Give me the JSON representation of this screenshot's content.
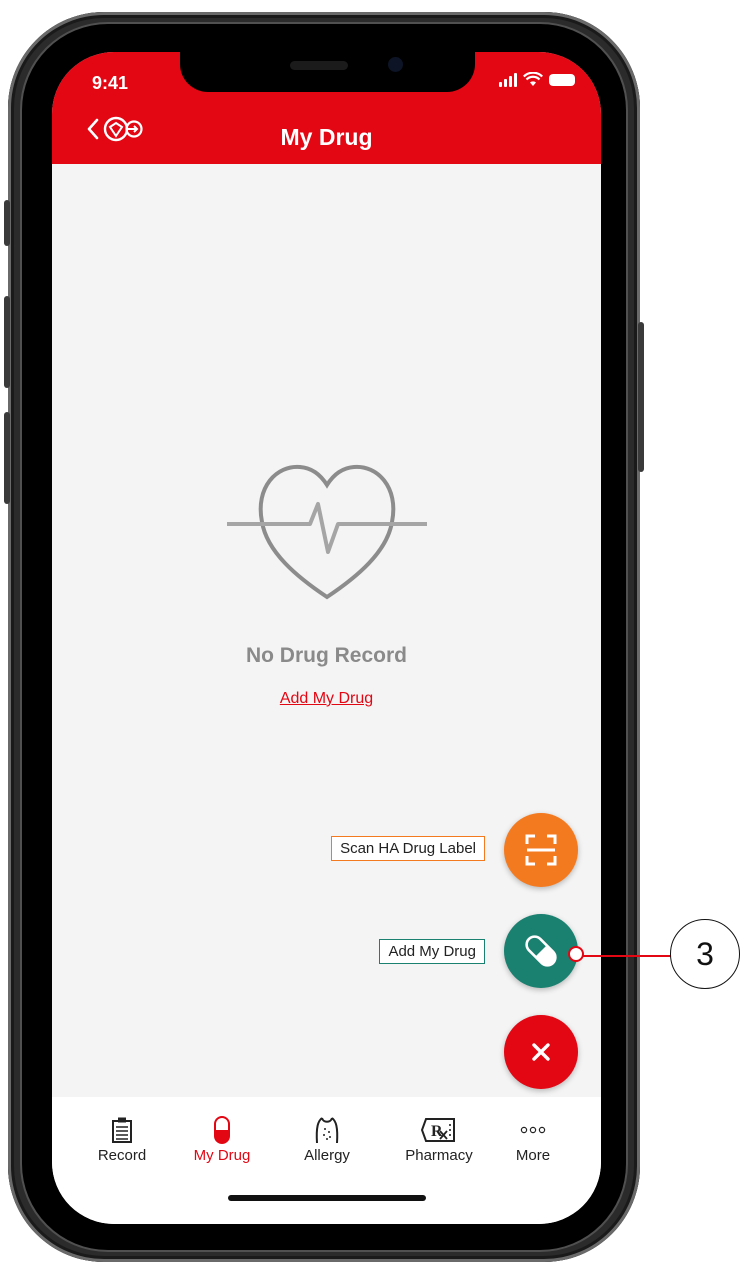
{
  "status_bar": {
    "time": "9:41"
  },
  "header": {
    "title": "My Drug"
  },
  "empty_state": {
    "title": "No Drug Record",
    "link": "Add My Drug"
  },
  "fab_menu": {
    "scan_label": "Scan HA Drug Label",
    "add_label": "Add My Drug"
  },
  "tabs": [
    {
      "label": "Record",
      "icon": "clipboard-icon"
    },
    {
      "label": "My Drug",
      "icon": "capsule-icon"
    },
    {
      "label": "Allergy",
      "icon": "allergy-body-icon"
    },
    {
      "label": "Pharmacy",
      "icon": "rx-prescription-icon"
    },
    {
      "label": "More",
      "icon": "more-dots-icon"
    }
  ],
  "active_tab": "My Drug",
  "callout": {
    "number": "3"
  },
  "colors": {
    "brand_red": "#e30613",
    "scan_orange": "#f47a20",
    "add_teal": "#1a8070",
    "background": "#f4f4f4"
  }
}
